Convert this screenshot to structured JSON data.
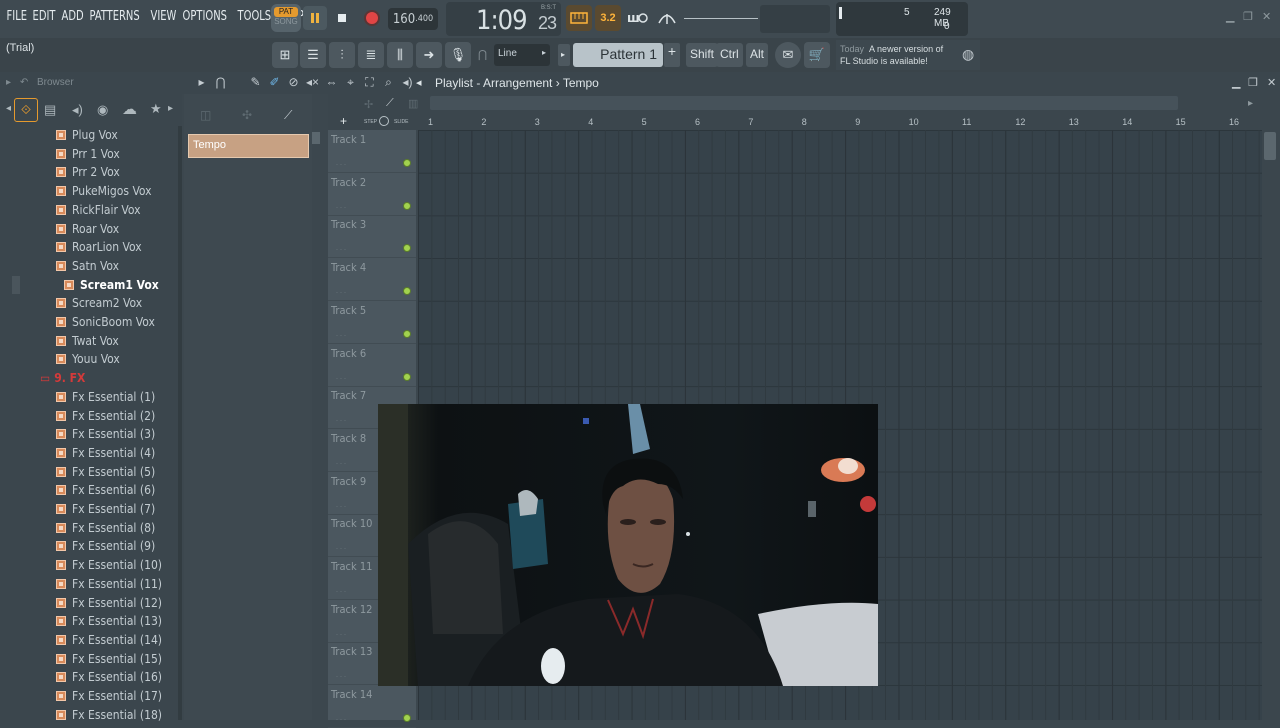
{
  "menu": [
    "FILE",
    "EDIT",
    "ADD",
    "PATTERNS",
    "VIEW",
    "OPTIONS",
    "TOOLS",
    "HELP"
  ],
  "transport": {
    "pat_label": "PAT",
    "song_label": "SONG",
    "tempo_int": "160",
    "tempo_frac": ".400",
    "time_main": "1:09",
    "time_sub": "23",
    "time_unit": "B:S:T",
    "step_label": "3.2"
  },
  "monitor": {
    "cpu": "5",
    "memory": "249 MB",
    "polyphony": "0"
  },
  "toolbar2": {
    "trial": "(Trial)",
    "snap": "Line",
    "pattern": "Pattern 1",
    "keys": [
      "Shift",
      "Ctrl",
      "Alt"
    ],
    "news_today": "Today",
    "news_line1": "A newer version of",
    "news_line2": "FL Studio is available!"
  },
  "browser": {
    "title": "Browser",
    "items": [
      "Plug Vox",
      "Prr 1 Vox",
      "Prr 2 Vox",
      "PukeMigos Vox",
      "RickFlair Vox",
      "Roar Vox",
      "RoarLion Vox",
      "Satn Vox",
      "Scream1 Vox",
      "Scream2 Vox",
      "SonicBoom Vox",
      "Twat Vox",
      "Youu Vox"
    ],
    "selected_index": 8,
    "folder": "9. FX",
    "fx_items": [
      "Fx Essential (1)",
      "Fx Essential (2)",
      "Fx Essential (3)",
      "Fx Essential (4)",
      "Fx Essential (5)",
      "Fx Essential (6)",
      "Fx Essential (7)",
      "Fx Essential (8)",
      "Fx Essential (9)",
      "Fx Essential (10)",
      "Fx Essential (11)",
      "Fx Essential (12)",
      "Fx Essential (13)",
      "Fx Essential (14)",
      "Fx Essential (15)",
      "Fx Essential (16)",
      "Fx Essential (17)",
      "Fx Essential (18)"
    ]
  },
  "playlist": {
    "crumb": "Playlist - Arrangement › Tempo",
    "clip": "Tempo",
    "step_label": "STEP",
    "slide_label": "SLIDE",
    "bars": [
      "1",
      "2",
      "3",
      "4",
      "5",
      "6",
      "7",
      "8",
      "9",
      "10",
      "11",
      "12",
      "13",
      "14",
      "15",
      "16"
    ],
    "tracks": [
      "Track 1",
      "Track 2",
      "Track 3",
      "Track 4",
      "Track 5",
      "Track 6",
      "Track 7",
      "Track 8",
      "Track 9",
      "Track 10",
      "Track 11",
      "Track 12",
      "Track 13",
      "Track 14"
    ]
  },
  "colors": {
    "accent_orange": "#e59a2e",
    "clip": "#c7a183",
    "folder_red": "#d43a3a",
    "track_dot": "#a2d24f"
  }
}
